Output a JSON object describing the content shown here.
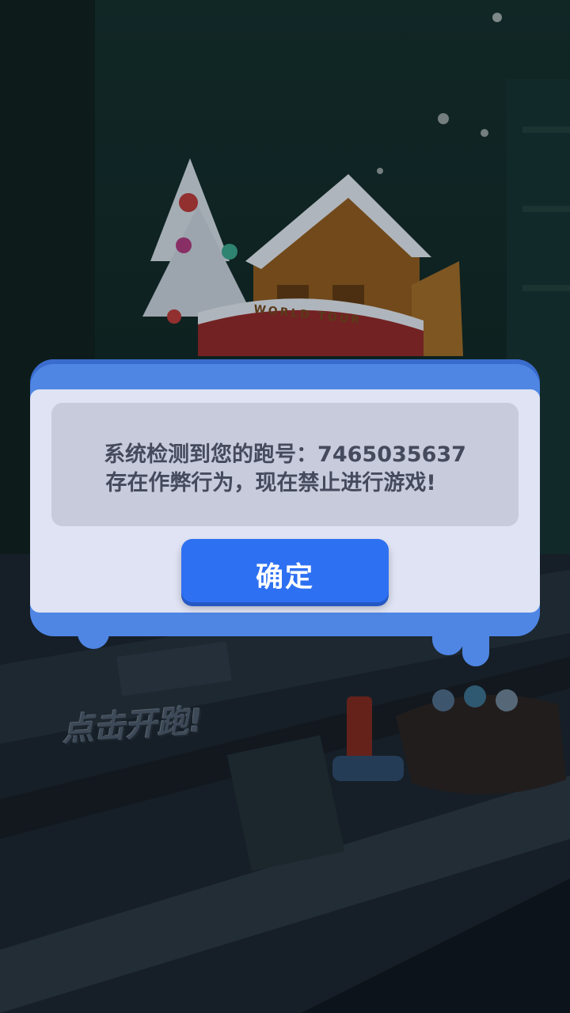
{
  "dialog": {
    "message_line1": "系统检测到您的跑号：7465035637",
    "message_line2": "存在作弊行为，现在禁止进行游戏!",
    "confirm_label": "确定"
  },
  "background": {
    "tap_to_run": "点击开跑!",
    "logo_banner": "WORLD TOUR"
  },
  "colors": {
    "dialog_frame": "#4f86e4",
    "dialog_panel": "#dfe3f3",
    "message_box": "#c7cbdc",
    "confirm_button": "#2e70f2"
  }
}
